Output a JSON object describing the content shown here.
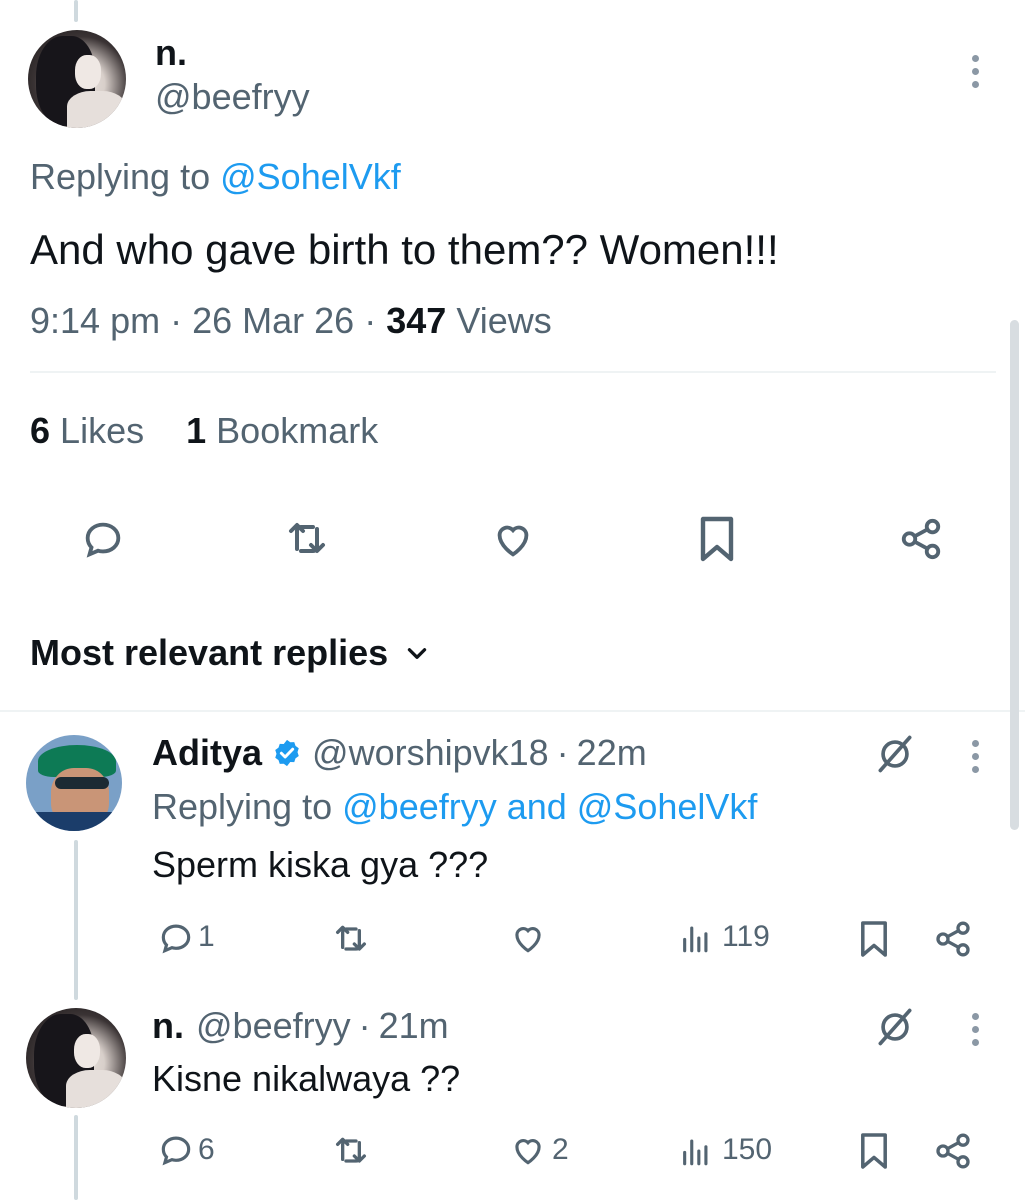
{
  "main_tweet": {
    "display_name": "n.",
    "handle": "@beefryy",
    "replying_prefix": "Replying to",
    "replying_to": "@SohelVkf",
    "text": "And who gave birth to them?? Women!!!",
    "time": "9:14 pm",
    "sep1": "·",
    "date": "26 Mar 26",
    "sep2": "·",
    "views_count": "347",
    "views_label": "Views",
    "likes_count": "6",
    "likes_label": "Likes",
    "bookmarks_count": "1",
    "bookmarks_label": "Bookmark"
  },
  "replies_sort": {
    "label": "Most relevant replies"
  },
  "replies": [
    {
      "display_name": "Aditya",
      "handle": "@worshipvk18",
      "sep": "·",
      "age": "22m",
      "replying_prefix": "Replying to",
      "replying_to": "@beefryy and @SohelVkf",
      "text": "Sperm kiska gya ???",
      "reply_count": "1",
      "like_count": "",
      "view_count": "119"
    },
    {
      "display_name": "n.",
      "handle": "@beefryy",
      "sep": "·",
      "age": "21m",
      "text": "Kisne nikalwaya ??",
      "reply_count": "6",
      "like_count": "2",
      "view_count": "150"
    }
  ],
  "colors": {
    "accent": "#1d9bf0",
    "verified": "#1d9bf0",
    "text": "#0f1419",
    "muted": "#536471"
  }
}
